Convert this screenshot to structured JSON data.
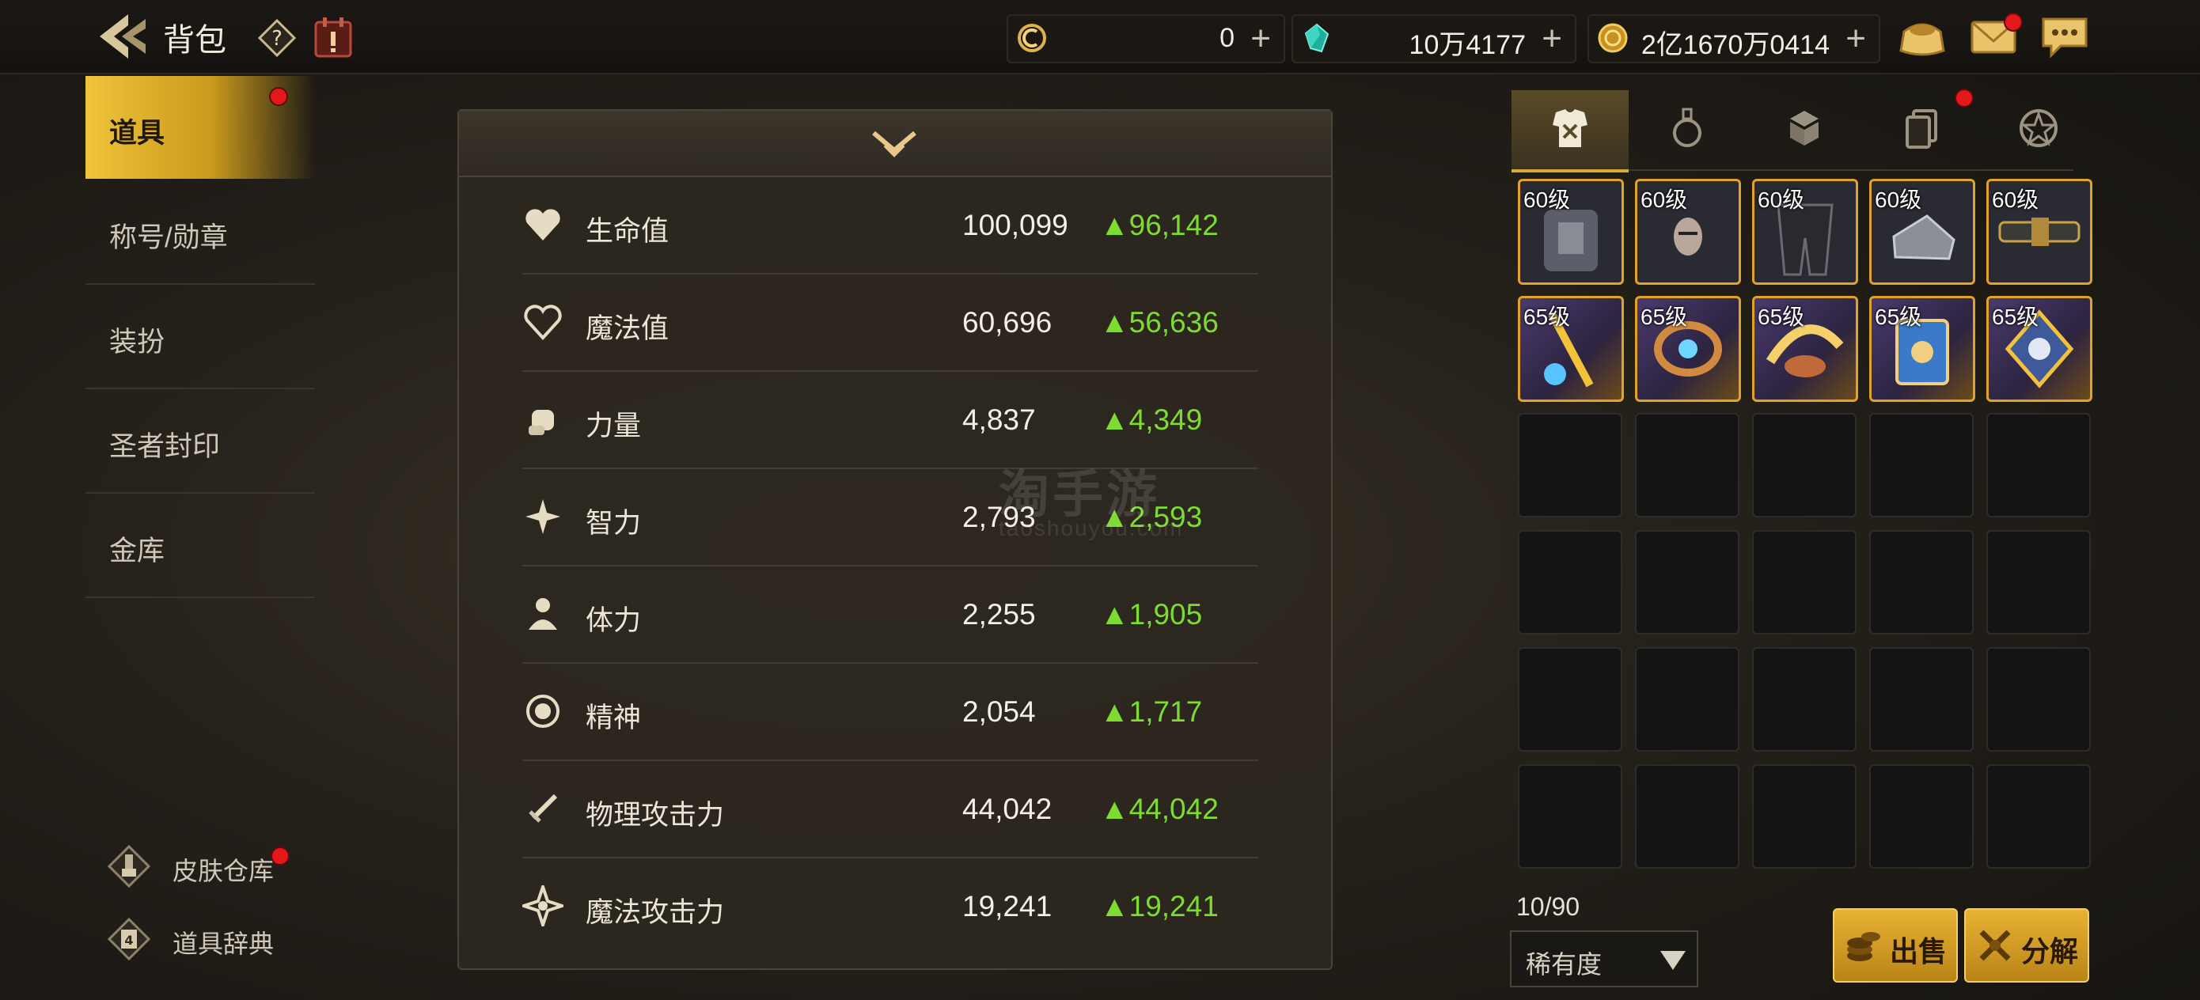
{
  "header": {
    "title": "背包",
    "currencies": [
      {
        "icon": "clock-coin-icon",
        "value": "0"
      },
      {
        "icon": "gem-icon",
        "value": "10万4177"
      },
      {
        "icon": "gold-coin-icon",
        "value": "2亿1670万0414"
      }
    ]
  },
  "sidebar": {
    "items": [
      {
        "label": "道具"
      },
      {
        "label": "称号/勋章"
      },
      {
        "label": "装扮"
      },
      {
        "label": "圣者封印"
      },
      {
        "label": "金库"
      }
    ],
    "bottom_links": [
      {
        "label": "皮肤仓库"
      },
      {
        "label": "道具辞典"
      }
    ]
  },
  "stats": {
    "rows": [
      {
        "icon": "heart-icon",
        "name": "生命值",
        "value": "100,099",
        "increase": "▲96,142"
      },
      {
        "icon": "heart-outline-icon",
        "name": "魔法值",
        "value": "60,696",
        "increase": "▲56,636"
      },
      {
        "icon": "fist-icon",
        "name": "力量",
        "value": "4,837",
        "increase": "▲4,349"
      },
      {
        "icon": "sparkle-icon",
        "name": "智力",
        "value": "2,793",
        "increase": "▲2,593"
      },
      {
        "icon": "body-icon",
        "name": "体力",
        "value": "2,255",
        "increase": "▲1,905"
      },
      {
        "icon": "spirit-icon",
        "name": "精神",
        "value": "2,054",
        "increase": "▲1,717"
      },
      {
        "icon": "sword-icon",
        "name": "物理攻击力",
        "value": "44,042",
        "increase": "▲44,042"
      },
      {
        "icon": "magic-star-icon",
        "name": "魔法攻击力",
        "value": "19,241",
        "increase": "▲19,241"
      }
    ]
  },
  "watermark": {
    "main": "淘手游",
    "sub": "taoshouyou.com"
  },
  "inventory": {
    "tabs": [
      "armor-icon",
      "potion-icon",
      "material-icon",
      "cards-icon",
      "emblem-icon"
    ],
    "items": [
      {
        "level": "60级",
        "icon": "chest-armor-icon"
      },
      {
        "level": "60级",
        "icon": "helmet-icon"
      },
      {
        "level": "60级",
        "icon": "pants-icon"
      },
      {
        "level": "60级",
        "icon": "boots-icon"
      },
      {
        "level": "60级",
        "icon": "belt-icon"
      },
      {
        "level": "65级",
        "icon": "necklace-icon"
      },
      {
        "level": "65级",
        "icon": "bracelet-icon"
      },
      {
        "level": "65级",
        "icon": "wing-ring-icon"
      },
      {
        "level": "65级",
        "icon": "book-icon"
      },
      {
        "level": "65级",
        "icon": "emblem-accessory-icon"
      }
    ],
    "capacity": "10/90",
    "sort_label": "稀有度",
    "sell_label": "出售",
    "dismantle_label": "分解"
  },
  "colors": {
    "accent": "#e8b235",
    "increase": "#7ddc32",
    "notify": "#e4171b"
  }
}
